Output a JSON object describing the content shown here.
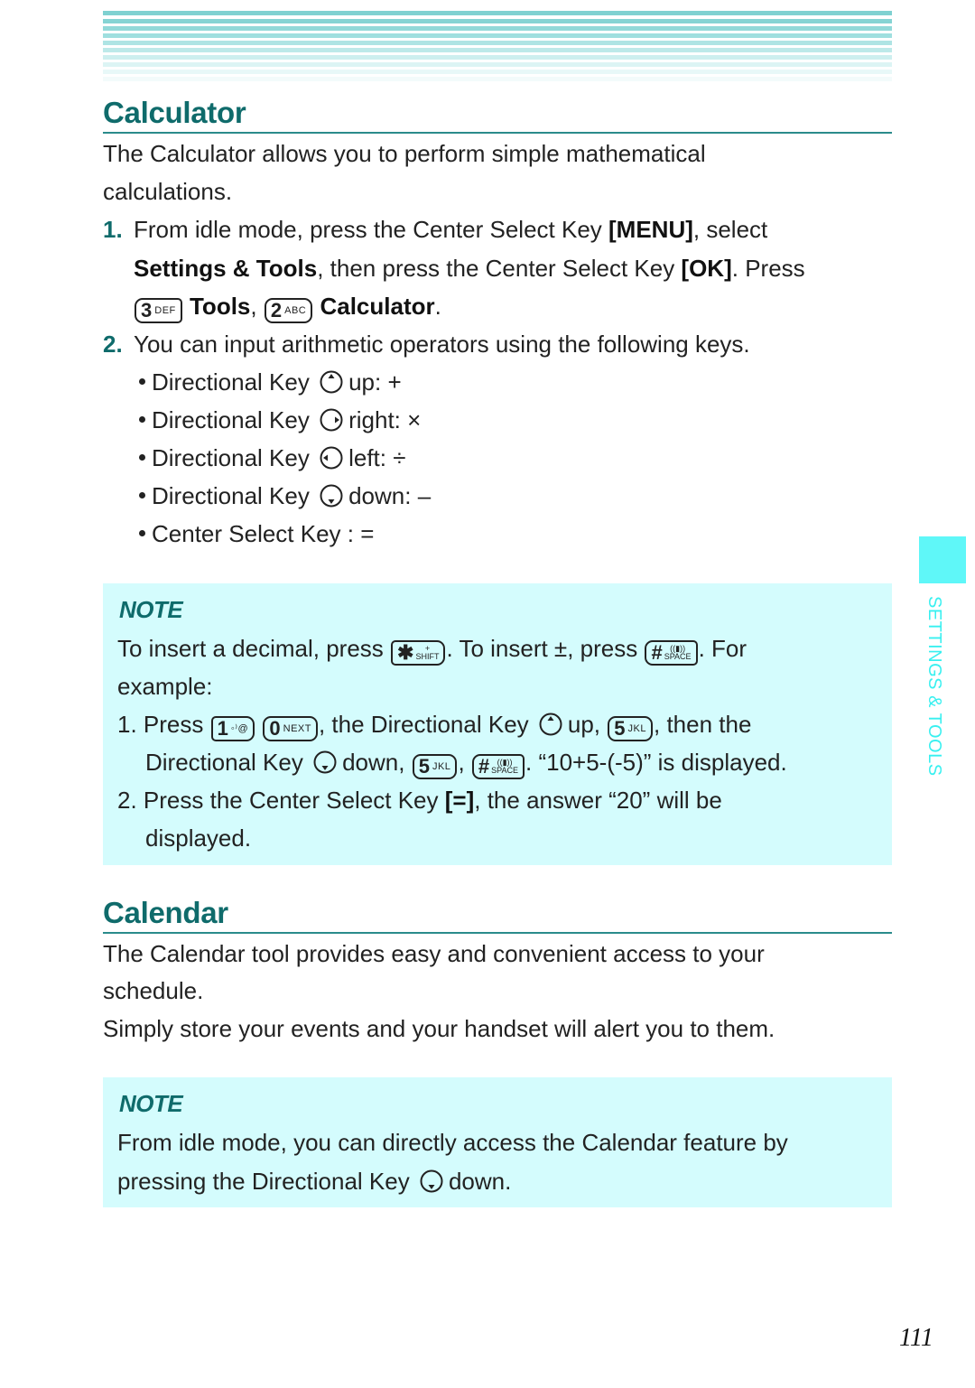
{
  "calculator": {
    "title": "Calculator",
    "intro_line1": "The Calculator allows you to perform simple mathematical",
    "intro_line2": "calculations.",
    "step1": {
      "num": "1.",
      "line1_a": "From idle mode, press the Center Select Key ",
      "line1_b": "[MENU]",
      "line1_c": ", select",
      "line2_a": "Settings & Tools",
      "line2_b": ", then press the Center Select Key ",
      "line2_c": "[OK]",
      "line2_d": ". Press",
      "key3": {
        "digit": "3",
        "letters": "DEF"
      },
      "line3_a": "Tools",
      "line3_b": ",",
      "key2": {
        "digit": "2",
        "letters": "ABC"
      },
      "line3_c": "Calculator",
      "line3_d": "."
    },
    "step2": {
      "num": "2.",
      "text": "You can input arithmetic operators using the following keys."
    },
    "bullets": [
      {
        "label": "Directional Key",
        "icon": "directional-up-icon",
        "text": "up: +"
      },
      {
        "label": "Directional Key",
        "icon": "directional-right-icon",
        "text": "right: ×"
      },
      {
        "label": "Directional Key",
        "icon": "directional-left-icon",
        "text": "left: ÷"
      },
      {
        "label": "Directional Key",
        "icon": "directional-down-icon",
        "text": "down: –"
      },
      {
        "label": "Center Select Key : =",
        "icon": "",
        "text": ""
      }
    ],
    "note": {
      "title": "NOTE",
      "l1_a": "To insert a decimal, press",
      "l1_b": ". To insert ±, press",
      "l1_c": ". For",
      "l2": "example:",
      "i1_num": "1.",
      "i1_a": "Press",
      "i1_b": ", the Directional Key",
      "i1_c": "up,",
      "i1_d": ", then the",
      "i1_e": "Directional Key",
      "i1_f": "down,",
      "i1_g": ",",
      "i1_h": ". “10+5-(-5)” is displayed.",
      "i2_num": "2.",
      "i2_a": "Press the Center Select Key ",
      "i2_b": "[=]",
      "i2_c": ", the answer “20” will be",
      "i2_d": "displayed.",
      "keys": {
        "star": {
          "main": "✱",
          "top": "+",
          "bottom": "SHIFT"
        },
        "hash": {
          "main": "#",
          "top": "((▮))",
          "bottom": "SPACE"
        },
        "one": {
          "main": "1",
          "sub": "◦⁾@"
        },
        "zero": {
          "main": "0",
          "sub": "NEXT"
        },
        "five": {
          "main": "5",
          "sub": "JKL"
        }
      }
    }
  },
  "calendar": {
    "title": "Calendar",
    "p1_line1": "The Calendar tool provides easy and convenient access to your",
    "p1_line2": "schedule.",
    "p2": "Simply store your events and your handset will alert you to them.",
    "note": {
      "title": "NOTE",
      "l1": "From idle mode, you can directly access the Calendar feature by",
      "l2_a": "pressing the Directional Key",
      "l2_b": "down."
    }
  },
  "side_tab": {
    "label": "SETTINGS & TOOLS",
    "color": "#5ff7f8"
  },
  "page_number": "111",
  "colors": {
    "heading": "#0f6b6b",
    "note_bg": "#d4fcfd",
    "stripe": "#7fd1d1"
  }
}
